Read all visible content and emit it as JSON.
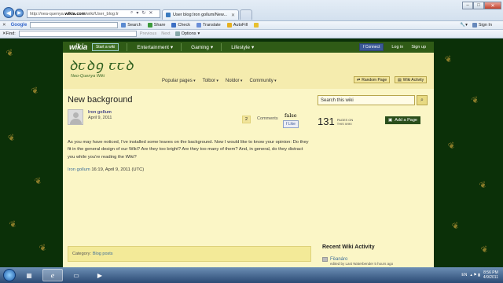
{
  "browser": {
    "address_url_prefix": "http://nea-quenya.",
    "address_url_domain": "wikia.com",
    "address_url_suffix": "/wiki/User_blog:Ir",
    "tab_title": "User blog:Iron gollum/New...",
    "toolbar": {
      "google_label": "Google",
      "search_label": "Search",
      "share_label": "Share",
      "check_label": "Check",
      "translate_label": "Translate",
      "autofill_label": "AutoFill",
      "sign_in_label": "Sign In"
    },
    "findbar": {
      "find_label": "Find:",
      "previous_label": "Previous",
      "next_label": "Next",
      "options_label": "Options"
    }
  },
  "wiki": {
    "brand": "wikia",
    "start_wiki_label": "Start a wiki",
    "hubs": [
      "Entertainment",
      "Gaming",
      "Lifestyle"
    ],
    "connect_label": "Connect",
    "login_label": "Log in",
    "signup_label": "Sign up",
    "logo_text": "ꝺꞇꝺꝯ ꞇꞇꝺ",
    "logo_sub": "Neo-Quenya Wiki",
    "nav": [
      "Popular pages",
      "Tolbor",
      "Noldor",
      "Community"
    ],
    "random_page_label": "Random Page",
    "wiki_activity_label": "Wiki Activity"
  },
  "article": {
    "title": "New background",
    "author": "Iron gollum",
    "date": "April 9, 2011",
    "comment_count": "2",
    "comments_label": "Comments",
    "false_text": "false",
    "like_label": "Like",
    "body": "As you may have noticed, I've installed some leaves on the background. Now I would like to know your opinion: Do they fit in the general design of our Wiki? Are they too bright? Are they too many of them? And, in general, do they distract you while you're reading the Wiki?",
    "signature_user": "Iron gollum",
    "signature_time": "16:19, April 9, 2011 (UTC)",
    "category_prefix": "Category:",
    "category": "Blog posts"
  },
  "rail": {
    "search_placeholder": "Search this wiki",
    "pages_count": "131",
    "pages_label_line1": "PAGES ON",
    "pages_label_line2": "THIS WIKI",
    "add_page_label": "Add a Page",
    "recent_title": "Recent Wiki Activity",
    "recent_item_title": "Fëanáro",
    "recent_item_meta": "edited by Last Waterbender 5 hours ago"
  },
  "taskbar": {
    "time": "8:56 PM",
    "date": "4/9/2011",
    "lang": "EN"
  }
}
